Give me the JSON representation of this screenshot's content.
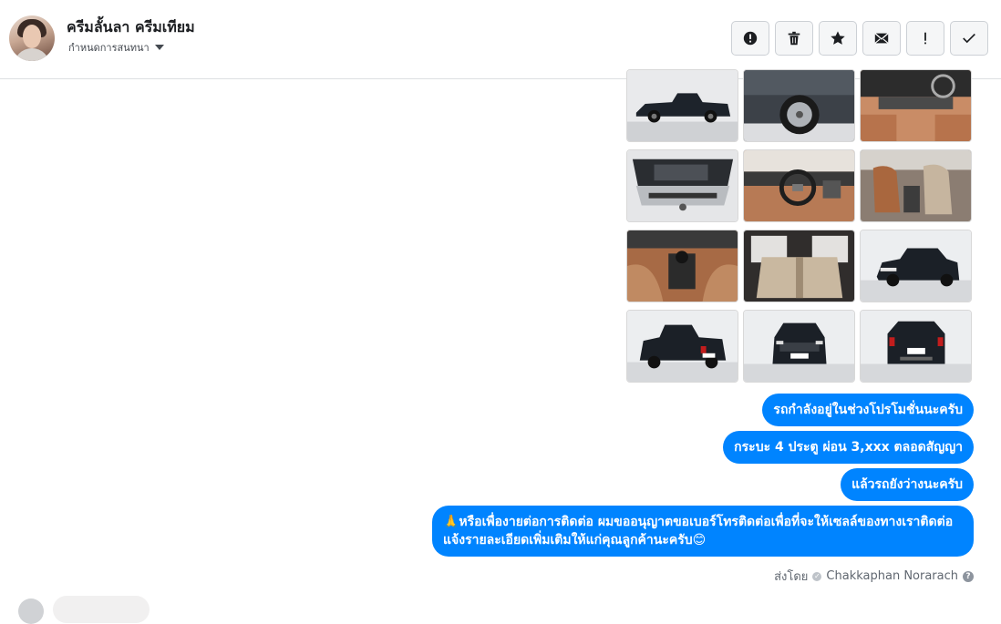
{
  "header": {
    "contact_name": "ครีมลั้นลา ครีมเทียม",
    "subtitle": "กำหนดการสนทนา",
    "actions": [
      {
        "name": "report-button",
        "icon": "alert-circle-icon"
      },
      {
        "name": "delete-button",
        "icon": "trash-icon"
      },
      {
        "name": "star-button",
        "icon": "star-icon"
      },
      {
        "name": "mark-unread-button",
        "icon": "envelope-icon"
      },
      {
        "name": "spam-button",
        "icon": "exclamation-icon"
      },
      {
        "name": "done-button",
        "icon": "checkmark-icon"
      }
    ]
  },
  "photos": [
    {
      "name": "photo-truck-side"
    },
    {
      "name": "photo-wheel-closeup"
    },
    {
      "name": "photo-dashboard"
    },
    {
      "name": "photo-engine-bay"
    },
    {
      "name": "photo-steering-wheel"
    },
    {
      "name": "photo-front-seats"
    },
    {
      "name": "photo-gear-shift"
    },
    {
      "name": "photo-rear-seats"
    },
    {
      "name": "photo-truck-front-angle"
    },
    {
      "name": "photo-truck-rear-angle"
    },
    {
      "name": "photo-truck-front"
    },
    {
      "name": "photo-truck-rear"
    }
  ],
  "messages": [
    {
      "text": "รถกำลังอยู่ในช่วงโปรโมชั่นนะครับ"
    },
    {
      "text": "กระบะ 4 ประตู ผ่อน 3,xxx ตลอดสัญญา"
    },
    {
      "text": "แล้วรถยังว่างนะครับ"
    },
    {
      "text": "🙏หรือเพื่องายต่อการติดต่อ ผมขออนุญาตขอเบอร์โทรติดต่อเพื่อที่จะให้เซลล์ของทางเราติดต่อแจ้งรายละเอียดเพิ่มเติมให้แก่คุณลูกค้านะครับ😊"
    }
  ],
  "sent_by": {
    "label": "ส่งโดย",
    "sender": "Chakkaphan Norarach",
    "help": "?"
  },
  "colors": {
    "bubble": "#0084ff",
    "border": "#dddfe2"
  }
}
